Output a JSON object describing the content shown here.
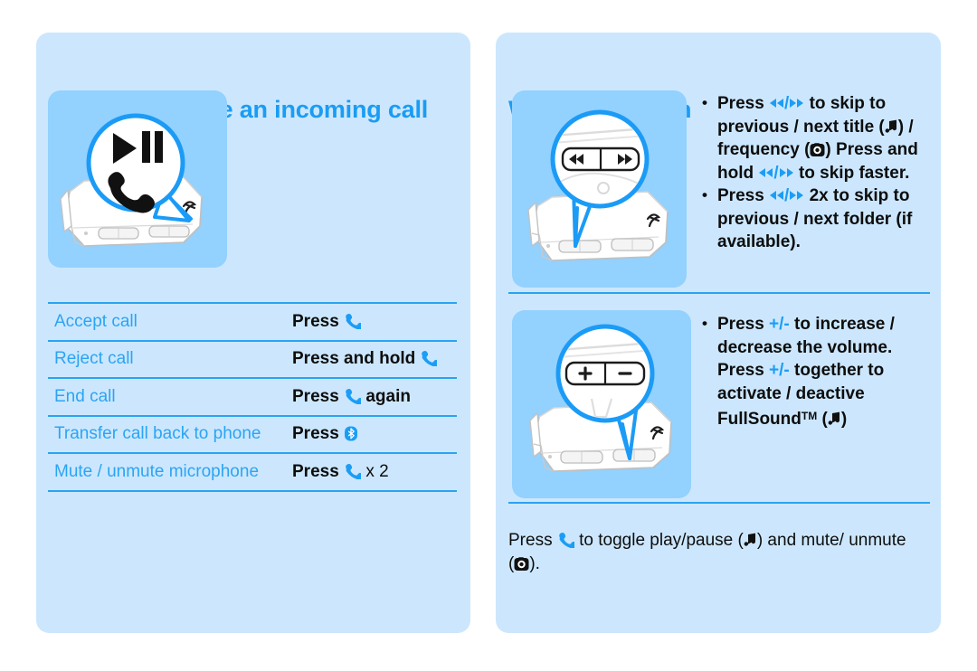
{
  "document": {
    "background": "#ffffff",
    "panel_bg": "#cce7fd",
    "illustration_bg": "#93d1fe",
    "accent": "#1a9cf5",
    "rule_color": "#2aa3f2",
    "body_text": "#0d0d0d"
  },
  "left_panel": {
    "heading": "When you have an incoming call",
    "illustration": {
      "name": "headset-with-playpause-call-callout",
      "callout_icons": [
        "play-pause-icon",
        "phone-handset-icon"
      ],
      "device": "bluetooth-headset"
    },
    "table": {
      "rows": [
        {
          "label": "Accept call",
          "action_prefix": "Press",
          "icon": "phone-handset-icon",
          "action_suffix": ""
        },
        {
          "label": "Reject call",
          "action_prefix": "Press and hold",
          "icon": "phone-handset-icon",
          "action_suffix": ""
        },
        {
          "label": "End call",
          "action_prefix": "Press",
          "icon": "phone-handset-icon",
          "action_suffix": "again"
        },
        {
          "label": "Transfer call back to phone",
          "action_prefix": "Press",
          "icon": "bluetooth-icon",
          "action_suffix": ""
        },
        {
          "label": "Mute / unmute microphone",
          "action_prefix": "Press",
          "icon": "phone-handset-icon",
          "action_suffix": "x 2"
        }
      ]
    }
  },
  "right_panel": {
    "heading": "While you listen",
    "skip_section": {
      "illustration": {
        "name": "headset-skip-buttons-zoom-callout",
        "callout_buttons": [
          "rewind-button",
          "fast-forward-button"
        ]
      },
      "bullets": [
        {
          "id": "skip-title",
          "segments": [
            {
              "t": "text",
              "v": "Press "
            },
            {
              "t": "icon",
              "v": "rewind-icon"
            },
            {
              "t": "slash",
              "v": "/"
            },
            {
              "t": "icon",
              "v": "fast-forward-icon"
            },
            {
              "t": "text",
              "v": " to skip to previous / next title ("
            },
            {
              "t": "icon",
              "v": "music-note-icon"
            },
            {
              "t": "text",
              "v": ") / frequency ("
            },
            {
              "t": "icon",
              "v": "mic-mute-icon"
            },
            {
              "t": "text",
              "v": ") Press and hold "
            },
            {
              "t": "icon",
              "v": "rewind-icon"
            },
            {
              "t": "slash",
              "v": "/"
            },
            {
              "t": "icon",
              "v": "fast-forward-icon"
            },
            {
              "t": "text",
              "v": " to skip faster."
            }
          ]
        },
        {
          "id": "skip-folder",
          "segments": [
            {
              "t": "text",
              "v": "Press "
            },
            {
              "t": "icon",
              "v": "rewind-icon"
            },
            {
              "t": "slash",
              "v": "/"
            },
            {
              "t": "icon",
              "v": "fast-forward-icon"
            },
            {
              "t": "text",
              "v": " 2x to skip to previous / next folder (if available)."
            }
          ]
        }
      ]
    },
    "volume_section": {
      "illustration": {
        "name": "headset-volume-buttons-zoom-callout",
        "callout_buttons": [
          "plus-button",
          "minus-button"
        ]
      },
      "bullets": [
        {
          "id": "volume",
          "segments": [
            {
              "t": "text",
              "v": "Press "
            },
            {
              "t": "pm",
              "v": "+/-"
            },
            {
              "t": "text",
              "v": " to increase / decrease the volume. Press "
            },
            {
              "t": "pm",
              "v": "+/-"
            },
            {
              "t": "text",
              "v": " together to activate / deactive FullSound"
            },
            {
              "t": "tm",
              "v": "TM"
            },
            {
              "t": "text",
              "v": " ("
            },
            {
              "t": "icon",
              "v": "music-note-icon"
            },
            {
              "t": "text",
              "v": ")"
            }
          ]
        }
      ]
    },
    "footnote": {
      "segments": [
        {
          "t": "text",
          "v": "Press "
        },
        {
          "t": "icon",
          "v": "phone-handset-icon"
        },
        {
          "t": "text",
          "v": " to toggle play/pause ("
        },
        {
          "t": "icon",
          "v": "music-note-icon"
        },
        {
          "t": "text",
          "v": ") and mute/ unmute ("
        },
        {
          "t": "icon",
          "v": "mic-mute-icon"
        },
        {
          "t": "text",
          "v": ")."
        }
      ]
    }
  }
}
